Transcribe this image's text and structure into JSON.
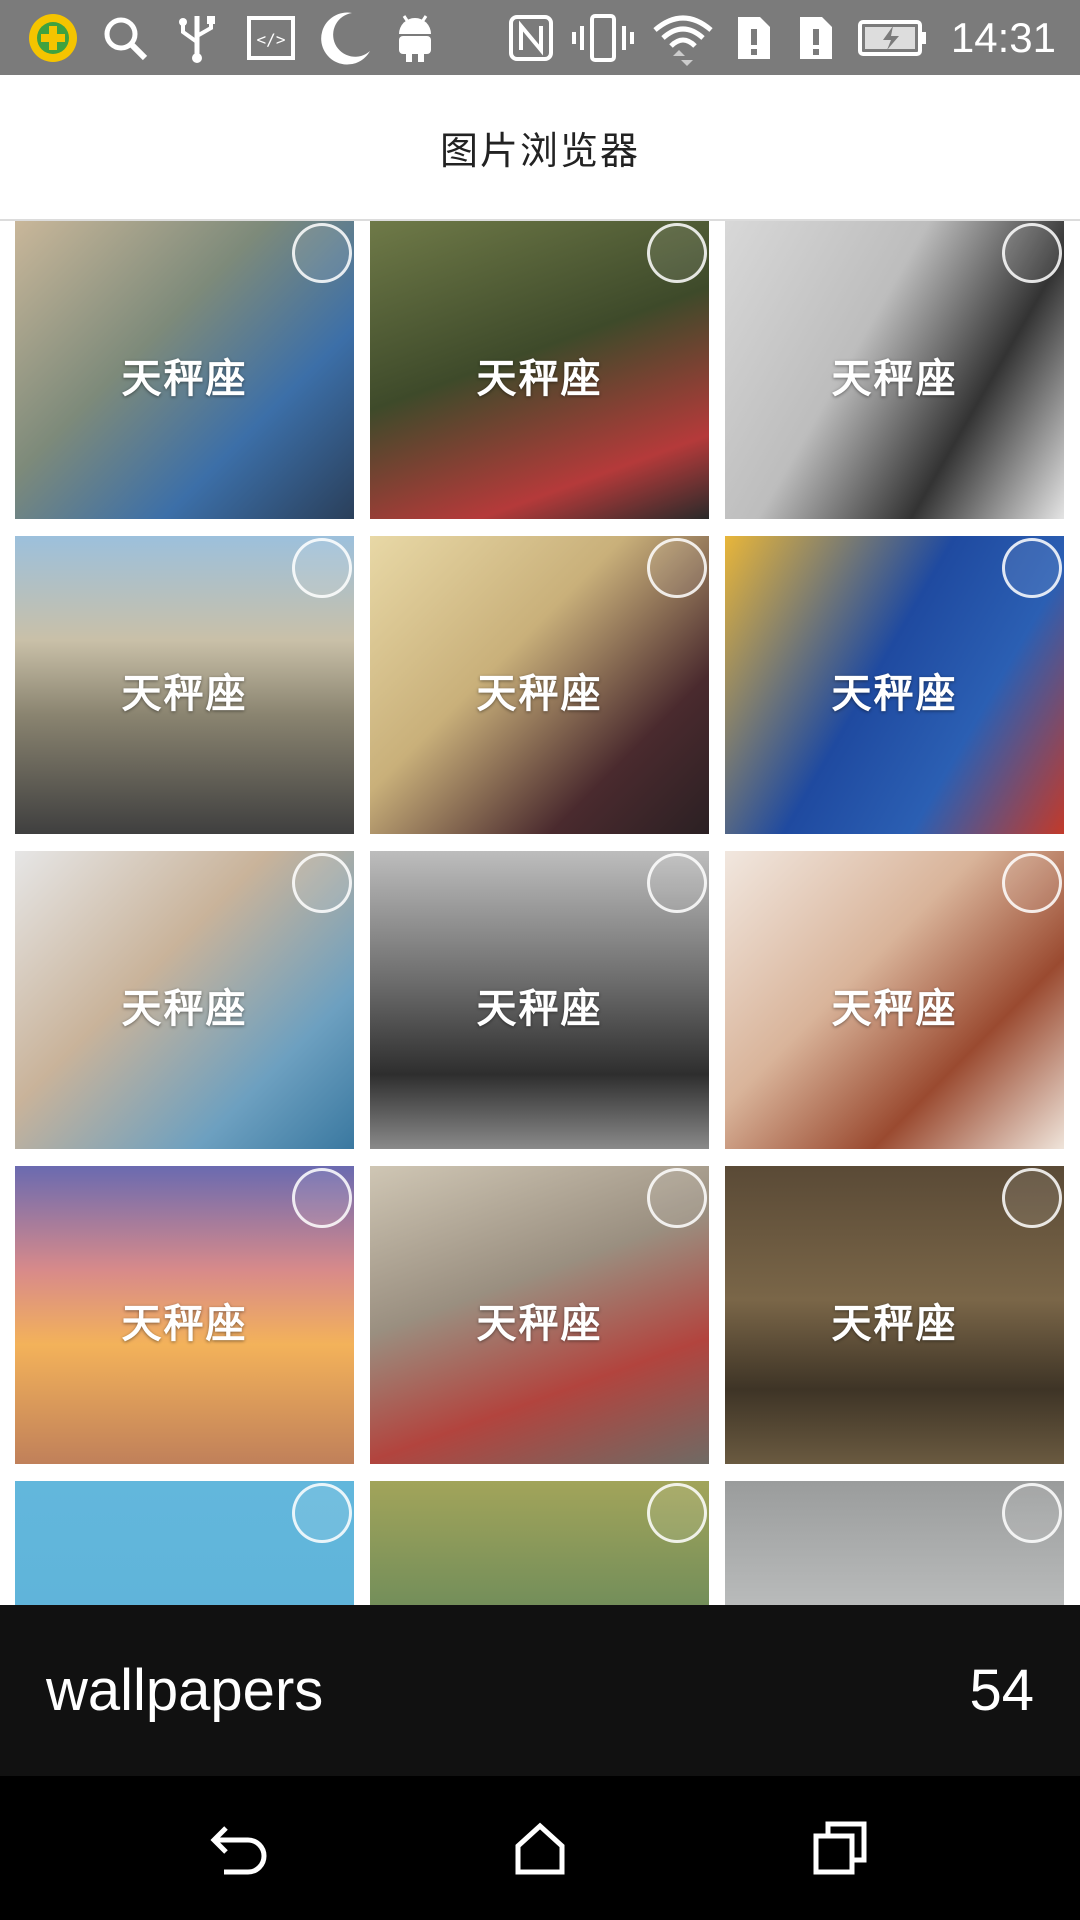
{
  "status_bar": {
    "time": "14:31",
    "icons": [
      "app-badge-icon",
      "search-icon",
      "usb-icon",
      "code-icon",
      "moon-icon",
      "android-icon",
      "nfc-icon",
      "vibrate-icon",
      "wifi-icon",
      "sim1-alert-icon",
      "sim2-alert-icon",
      "battery-charging-icon"
    ]
  },
  "header": {
    "title": "图片浏览器"
  },
  "grid": {
    "watermark": "天秤座",
    "tiles": [
      {
        "name": "kids-bus",
        "bg": "linear-gradient(135deg,#c9b79a 0%,#7d8a7a 40%,#3c6fa8 70%,#2a3f5a 100%)"
      },
      {
        "name": "train",
        "bg": "linear-gradient(160deg,#6f7a48 0%,#3e4a2a 45%,#b53a3a 80%,#2a2a2a 100%)"
      },
      {
        "name": "woman-wall",
        "bg": "linear-gradient(120deg,#d8d8d8 0%,#bdbdbd 40%,#333 70%,#e4e4e4 100%)"
      },
      {
        "name": "family-road",
        "bg": "linear-gradient(180deg,#9cc0dc 0%,#c9c0a8 35%,#8a8470 60%,#3f3f3f 100%)"
      },
      {
        "name": "clock",
        "bg": "linear-gradient(135deg,#e8d8a6 0%,#c9b07a 40%,#4a2a2e 75%,#2b2023 100%)"
      },
      {
        "name": "sign",
        "bg": "linear-gradient(120deg,#e8b63a 0%,#1f4aa0 45%,#2b5fb3 70%,#c23a2a 100%)"
      },
      {
        "name": "doves",
        "bg": "linear-gradient(135deg,#e6e6e6 0%,#c9b39a 40%,#6da0c0 75%,#3a78a0 100%)"
      },
      {
        "name": "girl-back",
        "bg": "linear-gradient(180deg,#bdbdbd 0%,#6a6a6a 45%,#2e2e2e 75%,#8a8a8a 100%)"
      },
      {
        "name": "red-hair",
        "bg": "linear-gradient(135deg,#f1e7df 0%,#d9b49a 40%,#9a4a30 70%,#efe4da 100%)"
      },
      {
        "name": "sunset-girl",
        "bg": "linear-gradient(180deg,#6a6ab0 0%,#d88a8a 35%,#f3b25a 60%,#c0805a 100%)"
      },
      {
        "name": "street",
        "bg": "linear-gradient(160deg,#cfc6b4 0%,#9a8f80 40%,#b2443e 70%,#6f6a64 100%)"
      },
      {
        "name": "room",
        "bg": "linear-gradient(180deg,#5a4a36 0%,#7a6648 45%,#3e3426 75%,#6a5a40 100%)"
      },
      {
        "name": "moon-sky",
        "bg": "linear-gradient(180deg,#62b7dc 0%,#5fb3d9 60%,#f1e49a 100%)"
      },
      {
        "name": "globe",
        "bg": "linear-gradient(180deg,#a2a45a 0%,#6a8a5a 50%,#c9b06a 100%)"
      },
      {
        "name": "scales",
        "bg": "linear-gradient(180deg,#9a9c9c 0%,#bfc1c1 50%,#8a8c8c 100%)"
      }
    ]
  },
  "album": {
    "name": "wallpapers",
    "count": "54"
  },
  "nav": {
    "back": "back-icon",
    "home": "home-icon",
    "recents": "recents-icon"
  }
}
